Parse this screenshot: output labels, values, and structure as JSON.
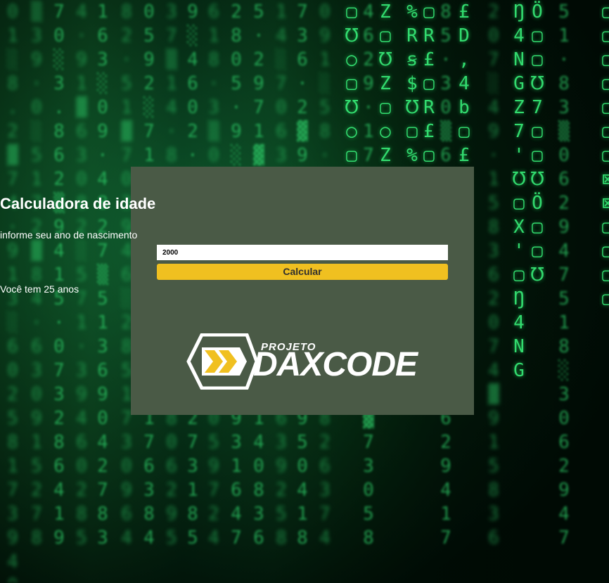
{
  "app": {
    "title": "Calculadora de idade",
    "prompt": "informe seu ano de nascimento",
    "birth_year_value": "2000",
    "calculate_label": "Calcular",
    "result_text": "Você tem 25 anos"
  },
  "logo": {
    "small_word": "PROJETO",
    "big_word": "DAXCODE"
  },
  "colors": {
    "card_bg": "#4a5a46",
    "button_bg": "#f0c020",
    "logo_accent": "#f0c020",
    "matrix_green": "#2fd36b"
  }
}
